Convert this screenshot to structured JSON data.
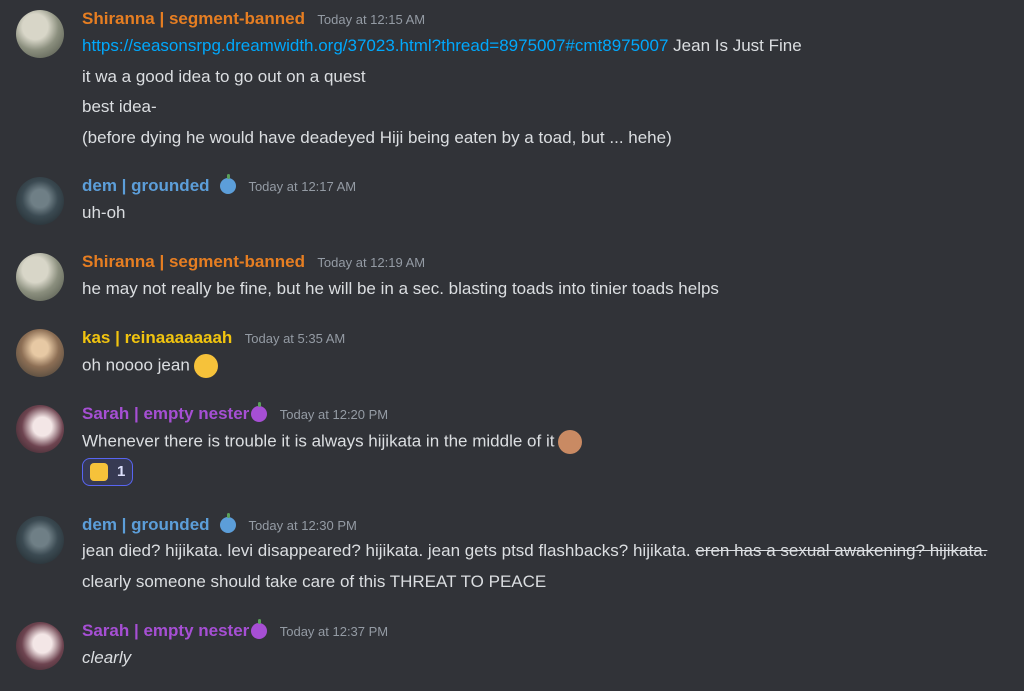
{
  "messages": [
    {
      "author": "Shiranna | segment-banned",
      "timestamp": "Today at 12:15 AM",
      "link_text": "https://seasonsrpg.dreamwidth.org/37023.html?thread=8975007#cmt8975007",
      "after_link": "Jean Is Just Fine",
      "lines": [
        "it wa a good idea to go out on a quest",
        "best idea-",
        "(before dying he would have deadeyed Hiji being eaten by a toad, but ... hehe)"
      ]
    },
    {
      "author": "dem | grounded",
      "timestamp": "Today at 12:17 AM",
      "lines": [
        "uh-oh"
      ]
    },
    {
      "author": "Shiranna | segment-banned",
      "timestamp": "Today at 12:19 AM",
      "lines": [
        "he may not really be fine, but he will be in a sec. blasting toads into tinier toads helps"
      ]
    },
    {
      "author": "kas | reinaaaaaaah",
      "timestamp": "Today at 5:35 AM",
      "lines": [
        "oh noooo jean"
      ]
    },
    {
      "author": "Sarah | empty nester",
      "timestamp": "Today at 12:20 PM",
      "lines": [
        "Whenever there is trouble it is always hijikata in the middle of it"
      ],
      "reaction_count": "1"
    },
    {
      "author": "dem | grounded",
      "timestamp": "Today at 12:30 PM",
      "line_plain": "jean died? hijikata. levi disappeared? hijikata. jean gets ptsd flashbacks? hijikata.",
      "line_strike": "eren has a sexual awakening? hijikata.",
      "lines": [
        "clearly someone should take care of this THREAT TO PEACE"
      ]
    },
    {
      "author": "Sarah | empty nester",
      "timestamp": "Today at 12:37 PM",
      "lines": [
        "clearly"
      ]
    }
  ],
  "colors": {
    "background": "#313338",
    "shiranna": "#e67e22",
    "dem": "#5c9ed9",
    "kas": "#f1c40f",
    "sarah": "#a64fd4",
    "link": "#00a8fc"
  },
  "icons": {
    "dem_badge": "blue-apple-icon",
    "sarah_badge": "purple-apple-icon",
    "kas_emoji": "loudly-crying-face-emoji",
    "sarah_emoji": "speak-no-evil-monkey-emoji",
    "reaction_emoji": "point-up-hand-emoji"
  }
}
